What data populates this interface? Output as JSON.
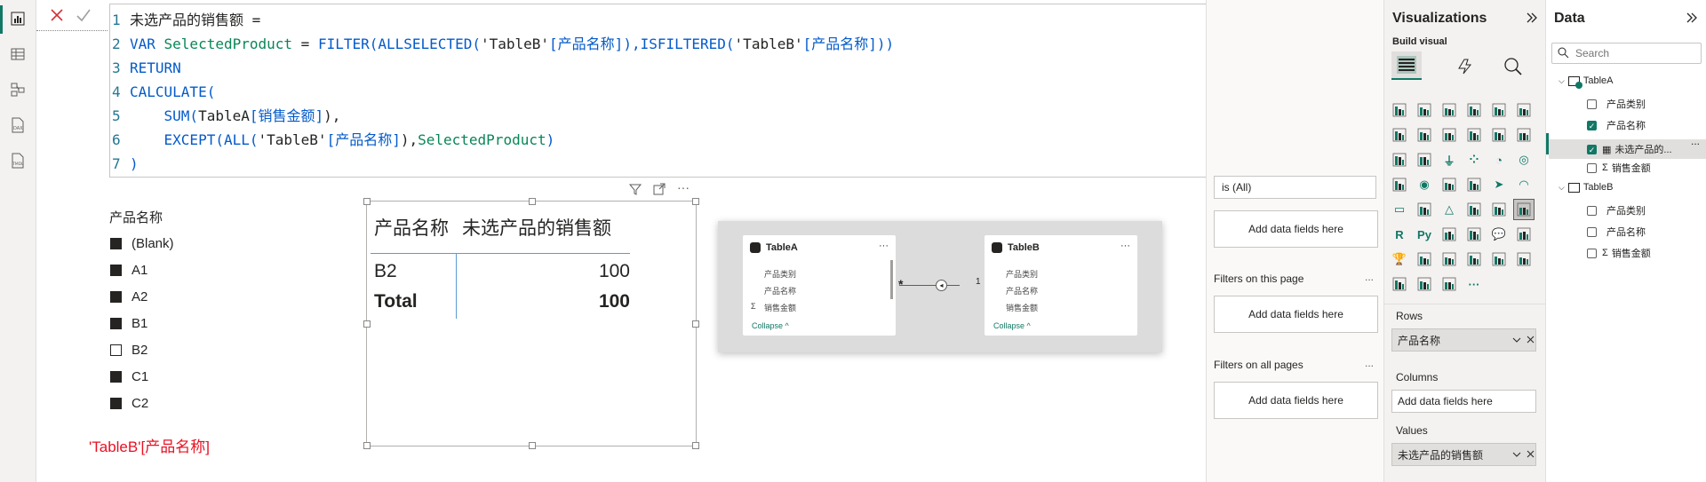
{
  "formula": {
    "lines": [
      {
        "num": "1",
        "segments": [
          {
            "t": "未选产品的销售额 =",
            "c": "pl"
          }
        ]
      },
      {
        "num": "2",
        "segments": [
          {
            "t": "VAR ",
            "c": "kw"
          },
          {
            "t": "SelectedProduct",
            "c": "var"
          },
          {
            "t": " = ",
            "c": "pl"
          },
          {
            "t": "FILTER(ALLSELECTED(",
            "c": "fn"
          },
          {
            "t": "'TableB'",
            "c": "pl"
          },
          {
            "t": "[产品名称]",
            "c": "fn"
          },
          {
            "t": "),ISFILTERED(",
            "c": "fn"
          },
          {
            "t": "'TableB'",
            "c": "pl"
          },
          {
            "t": "[产品名称]))",
            "c": "fn"
          }
        ]
      },
      {
        "num": "3",
        "segments": [
          {
            "t": "RETURN",
            "c": "kw"
          }
        ]
      },
      {
        "num": "4",
        "segments": [
          {
            "t": "CALCULATE(",
            "c": "fn"
          }
        ]
      },
      {
        "num": "5",
        "segments": [
          {
            "t": "    SUM(",
            "c": "fn"
          },
          {
            "t": "TableA",
            "c": "pl"
          },
          {
            "t": "[销售金额]",
            "c": "fn"
          },
          {
            "t": "),",
            "c": "pl"
          }
        ]
      },
      {
        "num": "6",
        "segments": [
          {
            "t": "    EXCEPT(ALL(",
            "c": "fn"
          },
          {
            "t": "'TableB'",
            "c": "pl"
          },
          {
            "t": "[产品名称]",
            "c": "fn"
          },
          {
            "t": "),",
            "c": "pl"
          },
          {
            "t": "SelectedProduct",
            "c": "var"
          },
          {
            "t": ")",
            "c": "fn"
          }
        ]
      },
      {
        "num": "7",
        "segments": [
          {
            "t": ")",
            "c": "fn"
          }
        ]
      }
    ]
  },
  "slicer": {
    "title": "产品名称",
    "items": [
      {
        "label": "(Blank)",
        "checked": true
      },
      {
        "label": "A1",
        "checked": true
      },
      {
        "label": "A2",
        "checked": true
      },
      {
        "label": "B1",
        "checked": true
      },
      {
        "label": "B2",
        "checked": false
      },
      {
        "label": "C1",
        "checked": true
      },
      {
        "label": "C2",
        "checked": true
      }
    ],
    "caption": "'TableB'[产品名称]"
  },
  "table_visual": {
    "headers": [
      "产品名称",
      "未选产品的销售额"
    ],
    "rows": [
      {
        "name": "B2",
        "value": "100"
      }
    ],
    "total": {
      "name": "Total",
      "value": "100"
    }
  },
  "model": {
    "tableA": {
      "name": "TableA",
      "fields": [
        "产品类别",
        "产品名称",
        "销售金额"
      ],
      "collapse": "Collapse"
    },
    "tableB": {
      "name": "TableB",
      "fields": [
        "产品类别",
        "产品名称",
        "销售金额"
      ],
      "collapse": "Collapse"
    },
    "rel_many": "*",
    "rel_one": "1"
  },
  "filters": {
    "is_all": "is (All)",
    "add1": "Add data fields here",
    "on_page": "Filters on this page",
    "add2": "Add data fields here",
    "on_all": "Filters on all pages",
    "add3": "Add data fields here",
    "more": "..."
  },
  "viz": {
    "title": "Visualizations",
    "build": "Build visual",
    "rows_label": "Rows",
    "rows_field": "产品名称",
    "columns_label": "Columns",
    "columns_placeholder": "Add data fields here",
    "values_label": "Values",
    "values_field": "未选产品的销售额",
    "more": "..."
  },
  "data_pane": {
    "title": "Data",
    "search_placeholder": "Search",
    "tableA": "TableA",
    "tableA_fields": [
      {
        "label": "产品类别",
        "checked": false
      },
      {
        "label": "产品名称",
        "checked": true
      },
      {
        "label": "未选产品的...",
        "checked": true
      },
      {
        "label": "销售金额",
        "checked": false
      }
    ],
    "tableB": "TableB",
    "tableB_fields": [
      {
        "label": "产品类别",
        "checked": false
      },
      {
        "label": "产品名称",
        "checked": false
      },
      {
        "label": "销售金额",
        "checked": false
      }
    ],
    "more": "..."
  },
  "colors": {
    "accent": "#117865",
    "keyword": "#035aca",
    "string": "#a31515",
    "var": "#098658",
    "caption": "#e81123"
  }
}
